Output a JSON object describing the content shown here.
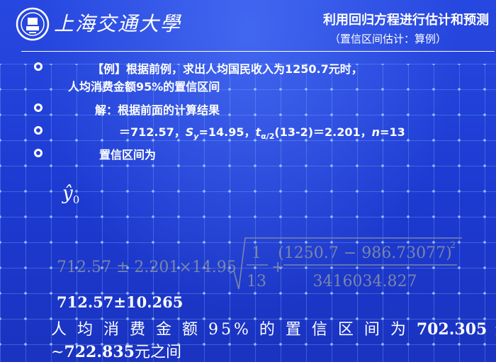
{
  "header": {
    "logo_text": "上海交通大學",
    "title": "利用回归方程进行估计和预测",
    "subtitle": "（置信区间估计：算例）"
  },
  "bullets": {
    "b1_line1": "【例】根据前例，求出人均国民收入为1250.7元时，",
    "b1_line2": "人均消费金额95%的置信区间",
    "b2": "解：根据前面的计算结果",
    "b3_eq": "＝712.57，",
    "b3_s": "S",
    "b3_s_sub": "y",
    "b3_s_val": "=14.95，",
    "b3_t": "t",
    "b3_t_sub": "α/2",
    "b3_t_val": "(13-2)＝2.201，",
    "b3_n": "n",
    "b3_n_val": "=13",
    "b4": "置信区间为"
  },
  "yhat": {
    "symbol": "ŷ",
    "sub": "0"
  },
  "formula": {
    "lhs": "712.57 ± 2.201×14.95",
    "frac1_num": "1",
    "frac1_den": "13",
    "plus": "+",
    "frac2_num": "(1250.7 − 986.73077)",
    "frac2_exp": "2",
    "frac2_den": "3416034.827"
  },
  "result": {
    "line1": "712.57±10.265",
    "line2_pre": "人 均 消 费 金 额 95% 的 置 信 区 间 为 ",
    "line2_val": "702.305",
    "line2_post": " 元",
    "line3_pre": "~",
    "line3_val": "722.835",
    "line3_post": "元之间"
  }
}
